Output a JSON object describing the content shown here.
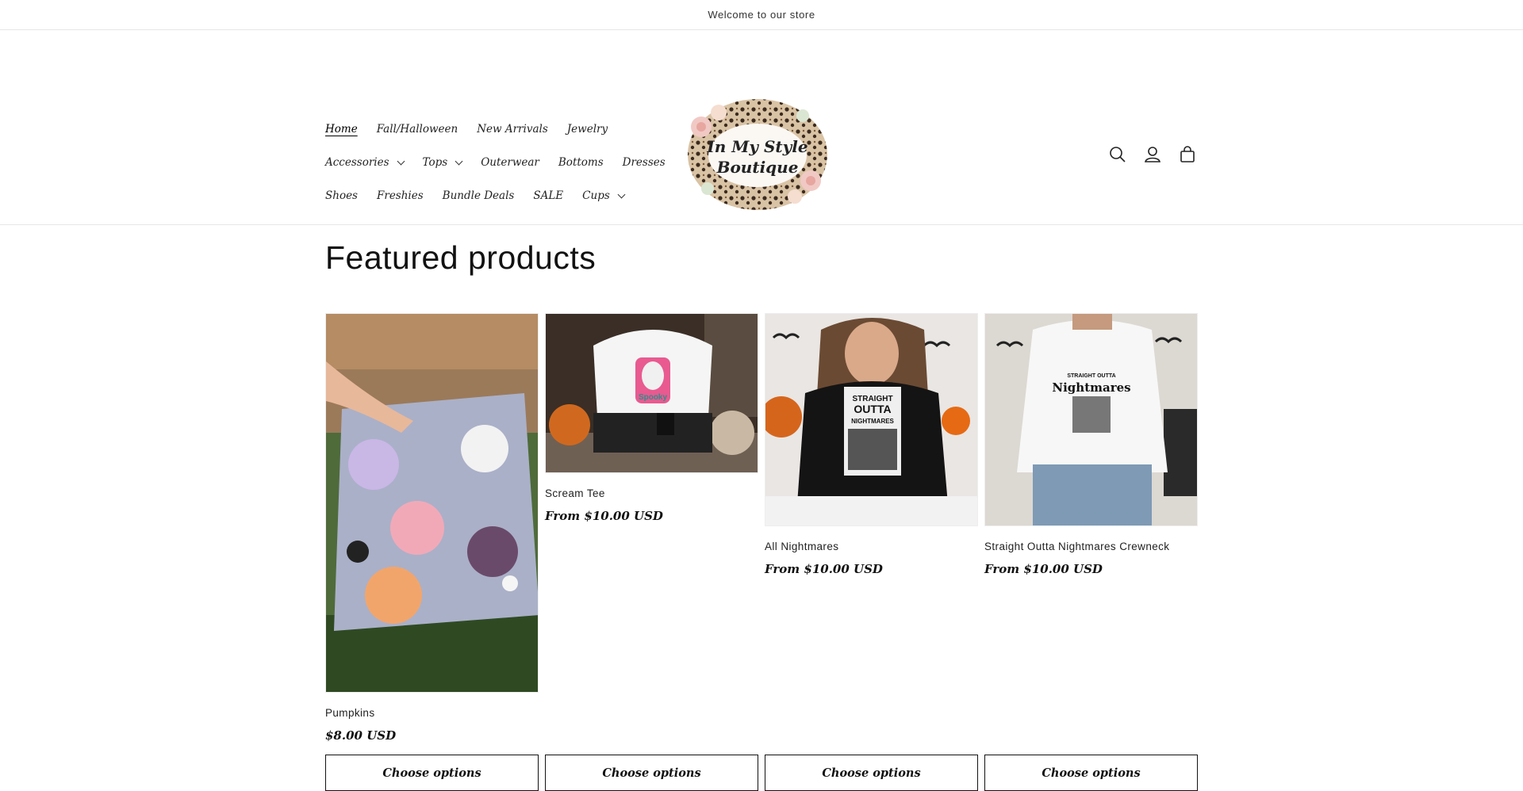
{
  "announcement": "Welcome to our store",
  "nav": {
    "row1": [
      "Home",
      "Fall/Halloween",
      "New Arrivals",
      "Jewelry"
    ],
    "row2": [
      "Accessories",
      "Tops",
      "Outerwear",
      "Bottoms",
      "Dresses"
    ],
    "row3": [
      "Shoes",
      "Freshies",
      "Bundle Deals",
      "SALE",
      "Cups"
    ]
  },
  "logo": {
    "line1": "In My Style",
    "line2": "Boutique"
  },
  "icons": [
    "search-icon",
    "account-icon",
    "cart-icon"
  ],
  "section_title": "Featured products",
  "products": [
    {
      "title": "Pumpkins",
      "price": "$8.00 USD",
      "button": "Choose options"
    },
    {
      "title": "Scream Tee",
      "price": "From $10.00 USD",
      "button": "Choose options"
    },
    {
      "title": "All Nightmares",
      "price": "From $10.00 USD",
      "button": "Choose options"
    },
    {
      "title": "Straight Outta Nightmares Crewneck",
      "price": "From $10.00 USD",
      "button": "Choose options"
    }
  ],
  "image_text": {
    "scream": "Spooky",
    "all_nightmares": {
      "line1": "STRAIGHT",
      "line2": "OUTTA",
      "line3": "NIGHTMARES"
    },
    "crewneck": {
      "line1": "STRAIGHT OUTTA",
      "line2": "Nightmares"
    }
  },
  "colors": {
    "accent": "#121212",
    "border": "#e6e6e6"
  }
}
